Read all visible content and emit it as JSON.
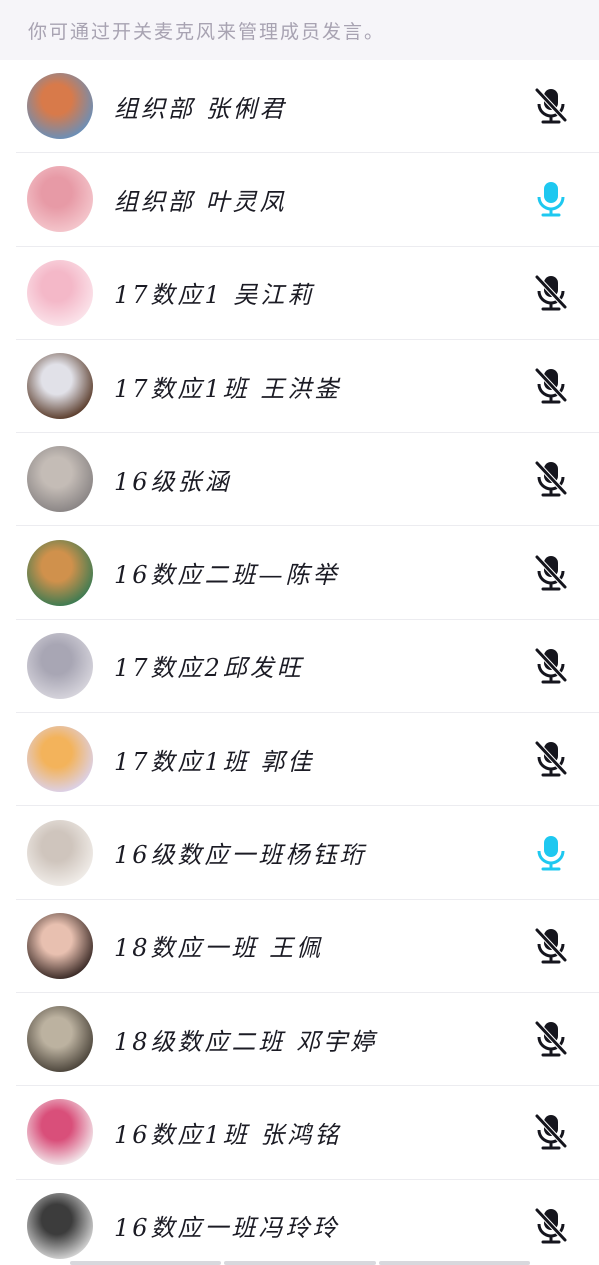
{
  "hint": "你可通过开关麦克风来管理成员发言。",
  "colors": {
    "mic_on": "#1ec8f0",
    "mic_off": "#15151d",
    "hint_bg": "#f6f5f9",
    "hint_text": "#a8a3b2"
  },
  "members": [
    {
      "name": "组织部  张俐君",
      "mic": "off",
      "mic_icon": "mic-off-icon",
      "avatar_bg": [
        "#6a8fb8",
        "#d87a4a"
      ]
    },
    {
      "name": "组织部  叶灵凤",
      "mic": "on",
      "mic_icon": "mic-on-icon",
      "avatar_bg": [
        "#f4c6cc",
        "#e79aa6"
      ]
    },
    {
      "name": "17数应1  吴江莉",
      "mic": "off",
      "mic_icon": "mic-off-icon",
      "avatar_bg": [
        "#fbe3ea",
        "#f4b8c8"
      ]
    },
    {
      "name": "17数应1班  王洪崟",
      "mic": "off",
      "mic_icon": "mic-off-icon",
      "avatar_bg": [
        "#5b3d2c",
        "#e1e1e8"
      ]
    },
    {
      "name": "16级张涵",
      "mic": "off",
      "mic_icon": "mic-off-icon",
      "avatar_bg": [
        "#8a8585",
        "#c4bcb6"
      ]
    },
    {
      "name": "16数应二班—陈举",
      "mic": "off",
      "mic_icon": "mic-off-icon",
      "avatar_bg": [
        "#3d7b52",
        "#d0914c"
      ]
    },
    {
      "name": "17数应2邱发旺",
      "mic": "off",
      "mic_icon": "mic-off-icon",
      "avatar_bg": [
        "#d6d4dc",
        "#a8a6b4"
      ]
    },
    {
      "name": "17数应1班  郭佳",
      "mic": "off",
      "mic_icon": "mic-off-icon",
      "avatar_bg": [
        "#dcd1e8",
        "#f3b35b"
      ]
    },
    {
      "name": "16级数应一班杨钰珩",
      "mic": "on",
      "mic_icon": "mic-on-icon",
      "avatar_bg": [
        "#f0ece8",
        "#cfc5bd"
      ]
    },
    {
      "name": "18数应一班  王佩",
      "mic": "off",
      "mic_icon": "mic-off-icon",
      "avatar_bg": [
        "#3a2a26",
        "#e8c0b0"
      ]
    },
    {
      "name": "18级数应二班  邓宇婷",
      "mic": "off",
      "mic_icon": "mic-off-icon",
      "avatar_bg": [
        "#4c453b",
        "#bcb2a0"
      ]
    },
    {
      "name": "16数应1班  张鸿铭",
      "mic": "off",
      "mic_icon": "mic-off-icon",
      "avatar_bg": [
        "#f2e6ea",
        "#d94f7a"
      ]
    },
    {
      "name": "16数应一班冯玲玲",
      "mic": "off",
      "mic_icon": "mic-off-icon",
      "avatar_bg": [
        "#d3d3d3",
        "#3c3c3c"
      ]
    }
  ]
}
